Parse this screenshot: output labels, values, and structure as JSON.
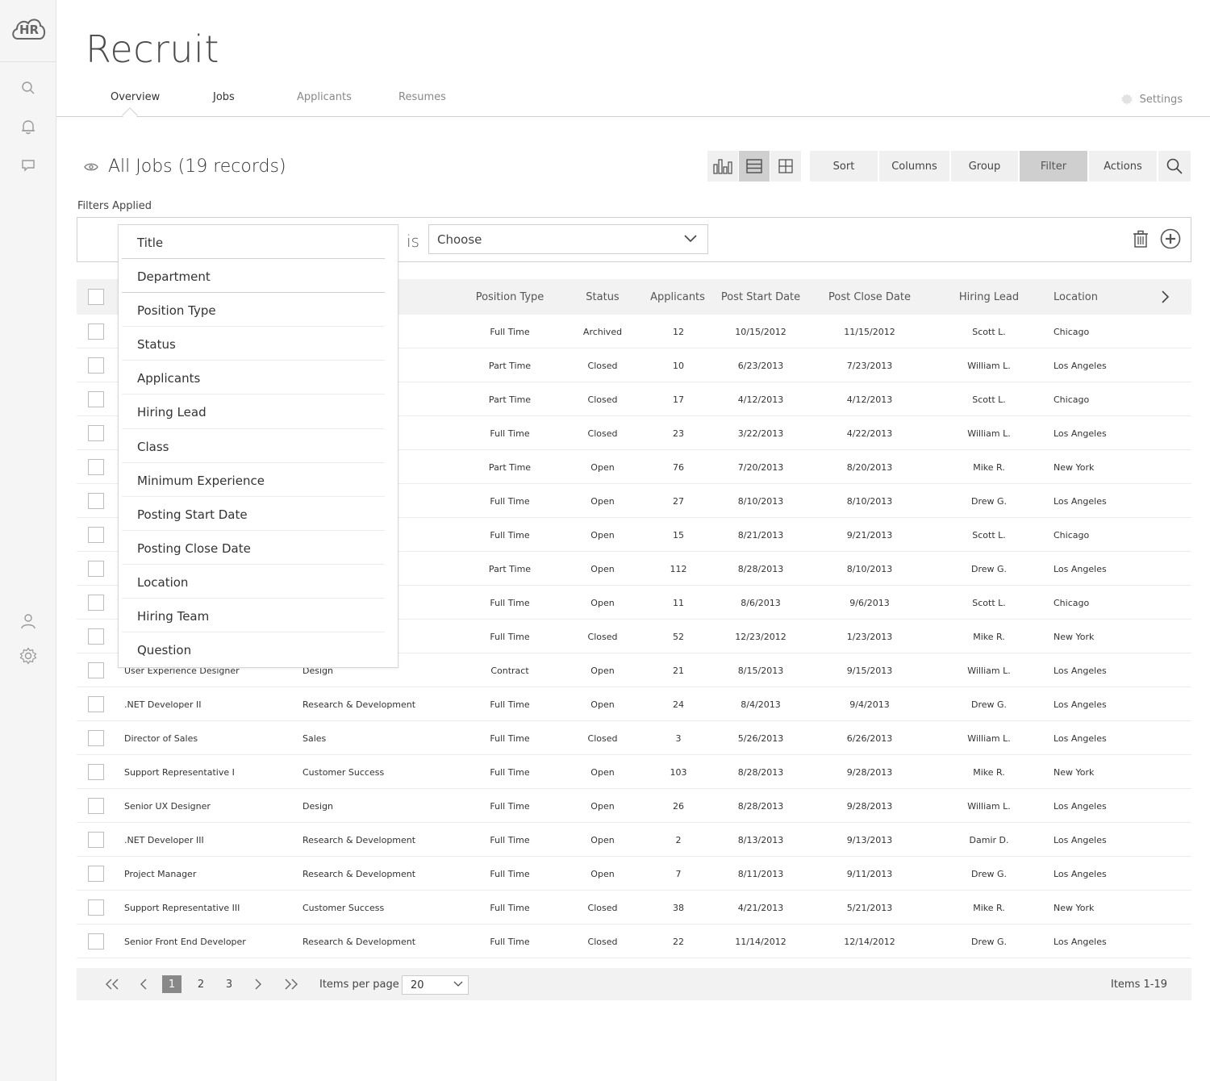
{
  "app": {
    "logo_text": "HR",
    "title": "Recruit"
  },
  "tabs": [
    {
      "label": "Overview"
    },
    {
      "label": "Jobs"
    },
    {
      "label": "Applicants"
    },
    {
      "label": "Resumes"
    }
  ],
  "settings_label": "Settings",
  "heading": "All Jobs (19 records)",
  "toolbar": {
    "sort": "Sort",
    "columns": "Columns",
    "group": "Group",
    "filter": "Filter",
    "actions": "Actions"
  },
  "filters": {
    "label": "Filters Applied",
    "operator": "is",
    "value_select": "Choose",
    "field_options": [
      "Title",
      "Department",
      "Position Type",
      "Status",
      "Applicants",
      "Hiring Lead",
      "Class",
      "Minimum Experience",
      "Posting Start Date",
      "Posting Close Date",
      "Location",
      "Hiring Team",
      "Question"
    ]
  },
  "columns": [
    "Position Type",
    "Status",
    "Applicants",
    "Post Start Date",
    "Post Close Date",
    "Hiring Lead",
    "Location"
  ],
  "rows": [
    {
      "title": "",
      "dept": "",
      "type": "Full Time",
      "status": "Archived",
      "applicants": "12",
      "start": "10/15/2012",
      "close": "11/15/2012",
      "lead": "Scott L.",
      "location": "Chicago"
    },
    {
      "title": "",
      "dept": "",
      "type": "Part Time",
      "status": "Closed",
      "applicants": "10",
      "start": "6/23/2013",
      "close": "7/23/2013",
      "lead": "William L.",
      "location": "Los Angeles"
    },
    {
      "title": "",
      "dept": "",
      "type": "Part Time",
      "status": "Closed",
      "applicants": "17",
      "start": "4/12/2013",
      "close": "4/12/2013",
      "lead": "Scott L.",
      "location": "Chicago"
    },
    {
      "title": "",
      "dept": "",
      "type": "Full Time",
      "status": "Closed",
      "applicants": "23",
      "start": "3/22/2013",
      "close": "4/22/2013",
      "lead": "William L.",
      "location": "Los Angeles"
    },
    {
      "title": "",
      "dept": "",
      "type": "Part Time",
      "status": "Open",
      "applicants": "76",
      "start": "7/20/2013",
      "close": "8/20/2013",
      "lead": "Mike R.",
      "location": "New York"
    },
    {
      "title": "",
      "dept": "ent",
      "type": "Full Time",
      "status": "Open",
      "applicants": "27",
      "start": "8/10/2013",
      "close": "8/10/2013",
      "lead": "Drew G.",
      "location": "Los Angeles"
    },
    {
      "title": "",
      "dept": "",
      "type": "Full Time",
      "status": "Open",
      "applicants": "15",
      "start": "8/21/2013",
      "close": "9/21/2013",
      "lead": "Scott L.",
      "location": "Chicago"
    },
    {
      "title": "",
      "dept": "ent",
      "type": "Part Time",
      "status": "Open",
      "applicants": "112",
      "start": "8/28/2013",
      "close": "8/10/2013",
      "lead": "Drew G.",
      "location": "Los Angeles"
    },
    {
      "title": "",
      "dept": "",
      "type": "Full Time",
      "status": "Open",
      "applicants": "11",
      "start": "8/6/2013",
      "close": "9/6/2013",
      "lead": "Scott L.",
      "location": "Chicago"
    },
    {
      "title": "",
      "dept": "",
      "type": "Full Time",
      "status": "Closed",
      "applicants": "52",
      "start": "12/23/2012",
      "close": "1/23/2013",
      "lead": "Mike R.",
      "location": "New York"
    },
    {
      "title": "User Experience Designer",
      "dept": "Design",
      "type": "Contract",
      "status": "Open",
      "applicants": "21",
      "start": "8/15/2013",
      "close": "9/15/2013",
      "lead": "William L.",
      "location": "Los Angeles"
    },
    {
      "title": ".NET Developer II",
      "dept": "Research & Development",
      "type": "Full Time",
      "status": "Open",
      "applicants": "24",
      "start": "8/4/2013",
      "close": "9/4/2013",
      "lead": "Drew G.",
      "location": "Los Angeles"
    },
    {
      "title": "Director of Sales",
      "dept": "Sales",
      "type": "Full Time",
      "status": "Closed",
      "applicants": "3",
      "start": "5/26/2013",
      "close": "6/26/2013",
      "lead": "William L.",
      "location": "Los Angeles"
    },
    {
      "title": "Support Representative I",
      "dept": "Customer Success",
      "type": "Full Time",
      "status": "Open",
      "applicants": "103",
      "start": "8/28/2013",
      "close": "9/28/2013",
      "lead": "Mike R.",
      "location": "New York"
    },
    {
      "title": "Senior UX Designer",
      "dept": "Design",
      "type": "Full Time",
      "status": "Open",
      "applicants": "26",
      "start": "8/28/2013",
      "close": "9/28/2013",
      "lead": "William L.",
      "location": "Los Angeles"
    },
    {
      "title": ".NET Developer III",
      "dept": "Research & Development",
      "type": "Full Time",
      "status": "Open",
      "applicants": "2",
      "start": "8/13/2013",
      "close": "9/13/2013",
      "lead": "Damir D.",
      "location": "Los Angeles"
    },
    {
      "title": "Project Manager",
      "dept": "Research & Development",
      "type": "Full Time",
      "status": "Open",
      "applicants": "7",
      "start": "8/11/2013",
      "close": "9/11/2013",
      "lead": "Drew G.",
      "location": "Los Angeles"
    },
    {
      "title": "Support Representative III",
      "dept": "Customer Success",
      "type": "Full Time",
      "status": "Closed",
      "applicants": "38",
      "start": "4/21/2013",
      "close": "5/21/2013",
      "lead": "Mike R.",
      "location": "New York"
    },
    {
      "title": "Senior Front End Developer",
      "dept": "Research & Development",
      "type": "Full Time",
      "status": "Closed",
      "applicants": "22",
      "start": "11/14/2012",
      "close": "12/14/2012",
      "lead": "Drew G.",
      "location": "Los Angeles"
    }
  ],
  "pagination": {
    "pages": [
      "1",
      "2",
      "3"
    ],
    "current": "1",
    "items_per_page_label": "Items per page",
    "items_per_page": "20",
    "items_count": "Items 1-19"
  },
  "colors": {
    "rail_bg": "#f5f5f5",
    "active_btn": "#cfcfcf",
    "page_active": "#888888"
  }
}
